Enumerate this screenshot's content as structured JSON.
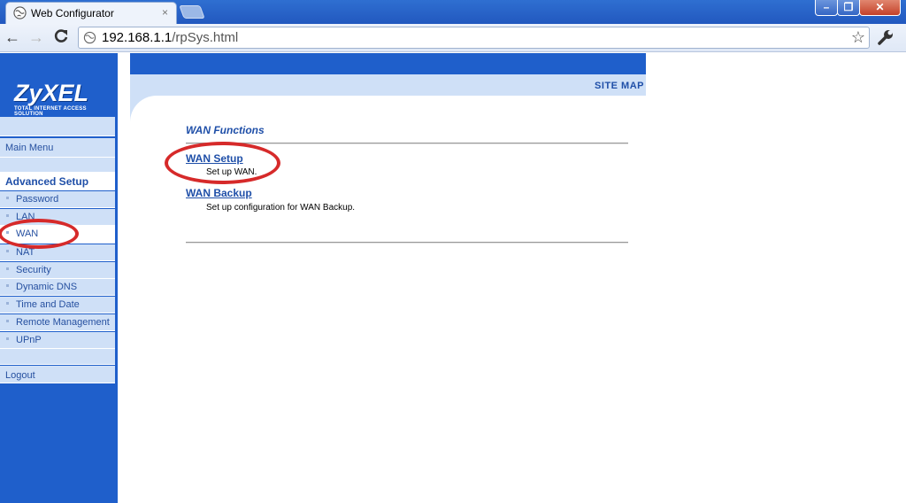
{
  "browser": {
    "tab_title": "Web Configurator",
    "tab_close": "×",
    "url_host": "192.168.1.1",
    "url_path": "/rpSys.html",
    "window_buttons": {
      "minimize": "–",
      "maximize": "❐",
      "close": "✕"
    },
    "nav": {
      "back": "←",
      "forward": "→",
      "reload": "C"
    },
    "star": "☆"
  },
  "brand": {
    "logo": "ZyXEL",
    "tagline": "TOTAL INTERNET ACCESS SOLUTION"
  },
  "sidebar": {
    "main_menu": "Main Menu",
    "advanced_setup": "Advanced Setup",
    "items": [
      {
        "label": "Password"
      },
      {
        "label": "LAN"
      },
      {
        "label": "WAN",
        "active": true
      },
      {
        "label": "NAT"
      },
      {
        "label": "Security"
      },
      {
        "label": "Dynamic DNS"
      },
      {
        "label": "Time and Date"
      },
      {
        "label": "Remote Management"
      },
      {
        "label": "UPnP"
      }
    ],
    "logout": "Logout"
  },
  "header": {
    "site_map": "SITE MAP"
  },
  "content": {
    "section_title": "WAN Functions",
    "functions": [
      {
        "link": "WAN Setup",
        "description": "Set up WAN."
      },
      {
        "link": "WAN Backup",
        "description": "Set up configuration for WAN Backup."
      }
    ]
  },
  "colors": {
    "brand_blue": "#1f5fcb",
    "nav_light": "#cfe0f7",
    "annotation_red": "#d62a2a"
  }
}
